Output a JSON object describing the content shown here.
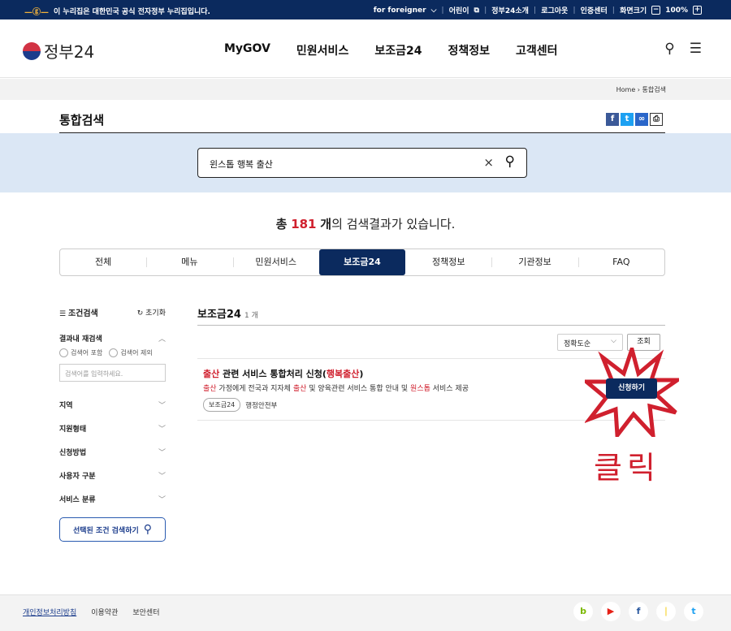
{
  "topbar": {
    "notice": "이 누리집은 대한민국 공식 전자정부 누리집입니다.",
    "links": [
      "for foreigner",
      "어린이",
      "정부24소개",
      "로그아웃",
      "인증센터",
      "화면크기"
    ],
    "zoom": "100%"
  },
  "header": {
    "logo": "정부24",
    "nav": [
      "MyGOV",
      "민원서비스",
      "보조금24",
      "정책정보",
      "고객센터"
    ]
  },
  "breadcrumb": {
    "home": "Home",
    "current": "통합검색"
  },
  "page": {
    "title": "통합검색"
  },
  "search": {
    "query": "윈스톱 행복 출산"
  },
  "summary": {
    "prefix": "총",
    "count": "181",
    "unit": "개",
    "suffix": "의 검색결과가 있습니다."
  },
  "tabs": [
    "전체",
    "메뉴",
    "민원서비스",
    "보조금24",
    "정책정보",
    "기관정보",
    "FAQ"
  ],
  "filter": {
    "title": "조건검색",
    "reset": "초기화",
    "refine_title": "결과내 재검색",
    "include": "검색어 포함",
    "exclude": "검색어 제외",
    "placeholder": "검색어를 입력하세요.",
    "sections": [
      "지역",
      "지원형태",
      "신청방법",
      "사용자 구분",
      "서비스 분류"
    ],
    "apply": "선택된 조건 검색하기"
  },
  "results": {
    "title": "보조금24",
    "count": "1 개",
    "sort": "정확도순",
    "sort_button": "조회",
    "item": {
      "title_hl1": "출산",
      "title_mid": " 관련 서비스 통합처리 신청(",
      "title_hl2": "행복출산",
      "title_end": ")",
      "desc_hl1": "출산",
      "desc_a": " 가정에게 전국과 지자체 ",
      "desc_hl2": "출산",
      "desc_b": " 및 양육관련 서비스 통합 안내 및 ",
      "desc_hl3": "원스톱",
      "desc_c": " 서비스 제공",
      "tag": "보조금24",
      "agency": "행정안전부",
      "action": "신청하기"
    }
  },
  "annotation": {
    "text": "클릭"
  },
  "footer": {
    "links": [
      "개인정보처리방침",
      "이용약관",
      "보안센터"
    ]
  },
  "colors": {
    "navy": "#0b2a5e",
    "accent_red": "#d0202e",
    "band": "#dbe7f5"
  }
}
